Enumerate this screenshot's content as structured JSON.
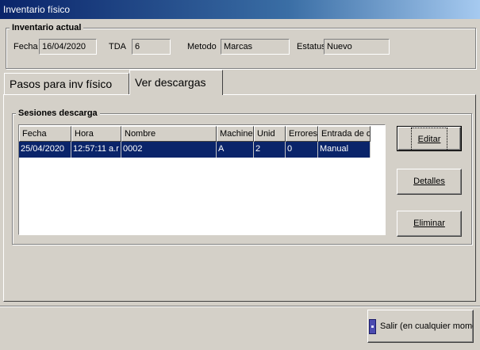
{
  "window": {
    "title": "Inventario físico"
  },
  "current": {
    "group_label": "Inventario actual",
    "fecha_label": "Fecha",
    "fecha_value": "16/04/2020",
    "tda_label": "TDA",
    "tda_value": "6",
    "metodo_label": "Metodo",
    "metodo_value": "Marcas",
    "estatus_label": "Estatus",
    "estatus_value": "Nuevo"
  },
  "tabs": [
    {
      "label": "Pasos para inv físico",
      "active": false
    },
    {
      "label": "Ver descargas",
      "active": true
    }
  ],
  "sessions": {
    "group_label": "Sesiones descarga",
    "columns": [
      "Fecha",
      "Hora",
      "Nombre",
      "Machine",
      "Unid",
      "Errores",
      "Entrada de d"
    ],
    "rows": [
      [
        "25/04/2020",
        "12:57:11 a.r",
        "0002",
        "A",
        "2",
        "0",
        "Manual"
      ]
    ],
    "selected_row": 0
  },
  "buttons": {
    "editar": "Editar",
    "detalles": "Detalles",
    "eliminar": "Eliminar",
    "salir": "Salir (en cualquier mome"
  },
  "icons": {
    "exit": "door-exit-icon"
  }
}
